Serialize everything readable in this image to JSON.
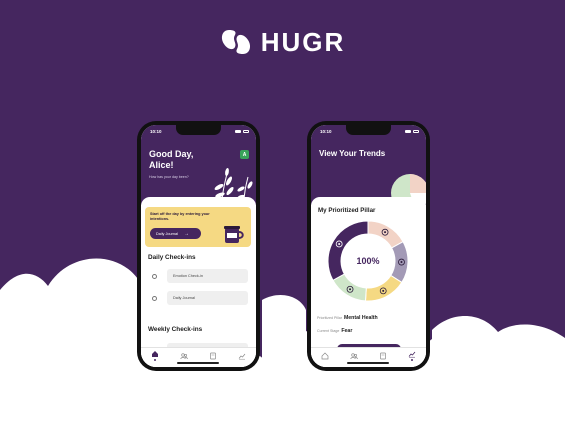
{
  "brand": {
    "name": "HUGR"
  },
  "colors": {
    "brand_purple": "#45265f",
    "accent_yellow": "#f5d983",
    "accent_green": "#39a25a",
    "background_cloud": "#ffffff"
  },
  "left_phone": {
    "status": {
      "time": "10:10"
    },
    "greeting": "Good Day, Alice!",
    "greeting_sub": "How has your day been?",
    "avatar_initial": "A",
    "intention_card": {
      "text": "Start off the day by entering your intentions.",
      "button_label": "Daily Journal",
      "button_icon": "arrow-right-icon"
    },
    "daily_checkins": {
      "title": "Daily Check-ins",
      "items": [
        {
          "label": "Emotion Check-in"
        },
        {
          "label": "Daily Journal"
        }
      ]
    },
    "weekly_checkins": {
      "title": "Weekly Check-ins"
    },
    "tabs": [
      {
        "icon": "home-icon",
        "active": true
      },
      {
        "icon": "people-icon",
        "active": false
      },
      {
        "icon": "journal-icon",
        "active": false
      },
      {
        "icon": "trends-icon",
        "active": false
      }
    ]
  },
  "right_phone": {
    "status": {
      "time": "10:10"
    },
    "title": "View Your Trends",
    "pillar_title": "My Prioritized Pillar",
    "donut": {
      "center_label": "100%",
      "segments": [
        {
          "color": "#f2d3c6",
          "icon": "sprout-icon",
          "fraction": 0.17
        },
        {
          "color": "#a39ab6",
          "icon": "link-icon",
          "fraction": 0.17
        },
        {
          "color": "#f5d983",
          "icon": "people-icon",
          "fraction": 0.17
        },
        {
          "color": "#cfe6c9",
          "icon": "monitor-icon",
          "fraction": 0.16
        },
        {
          "color": "#45265f",
          "icon": "brain-icon",
          "fraction": 0.33
        }
      ]
    },
    "prioritized_pillar": {
      "label": "Prioritized Pillar",
      "value": "Mental Health"
    },
    "current_stage": {
      "label": "Current Stage",
      "value": "Fear"
    },
    "tabs": [
      {
        "icon": "home-icon",
        "active": false
      },
      {
        "icon": "people-icon",
        "active": false
      },
      {
        "icon": "journal-icon",
        "active": false
      },
      {
        "icon": "trends-icon",
        "active": true
      }
    ]
  }
}
